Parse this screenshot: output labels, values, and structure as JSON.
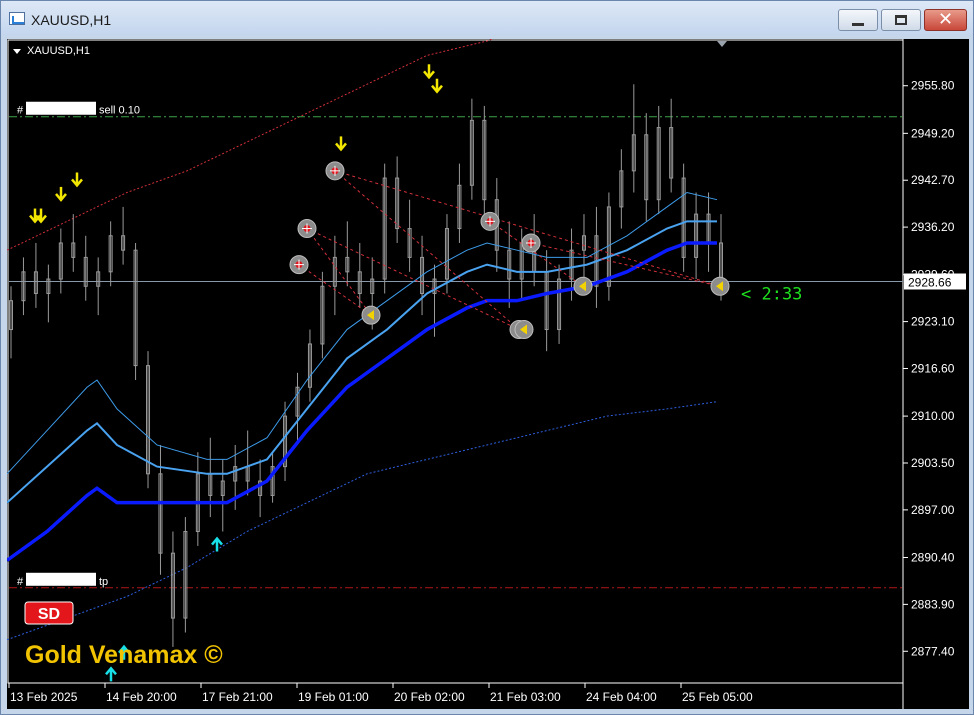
{
  "window": {
    "title": "XAUUSD,H1",
    "controls": {
      "minimize": "minimize",
      "maximize": "maximize",
      "close": "✕"
    }
  },
  "chart_header": {
    "symbol": "XAUUSD,H1"
  },
  "colors": {
    "background": "#000000",
    "candles": "#9a9a9a",
    "upper_band": "#d2303a",
    "ma_light": "#3d9be9",
    "ma_mid": "#4aa3f0",
    "ma_thick": "#0b1bff",
    "ma_slow": "#2e5fe0",
    "sell_line": "#3da34a",
    "tp_line": "#b01818",
    "current_price_line": "#8a98ac",
    "arrow_up": "#17e0e8",
    "arrow_down": "#f2e600",
    "countdown": "#1ee01e",
    "brand_text": "#f2c400",
    "sd_badge": "#e3161b"
  },
  "orders": {
    "sell": {
      "prefix": "#",
      "label": "sell 0.10"
    },
    "tp": {
      "prefix": "#",
      "label": "tp"
    }
  },
  "countdown": "< 2:33",
  "badge": "SD",
  "brand": "Gold Venamax ©",
  "chart_data": {
    "type": "candlestick",
    "symbol": "XAUUSD",
    "timeframe": "H1",
    "ylim": [
      2873.0,
      2962.0
    ],
    "y_ticks": [
      "2955.80",
      "2949.20",
      "2942.70",
      "2936.20",
      "2929.60",
      "2923.10",
      "2916.60",
      "2910.00",
      "2903.50",
      "2897.00",
      "2890.40",
      "2883.90",
      "2877.40"
    ],
    "x_ticks": [
      "13 Feb 2025",
      "14 Feb 20:00",
      "17 Feb 21:00",
      "19 Feb 01:00",
      "20 Feb 02:00",
      "21 Feb 03:00",
      "24 Feb 04:00",
      "25 Feb 05:00"
    ],
    "current_price": "2928.66",
    "current_price_value": 2928.66,
    "sell_level": 2951.5,
    "tp_level": 2886.2,
    "ohlc": [
      [
        2922,
        2928,
        2918,
        2926
      ],
      [
        2926,
        2932,
        2924,
        2930
      ],
      [
        2930,
        2934,
        2925,
        2927
      ],
      [
        2927,
        2931,
        2923,
        2929
      ],
      [
        2929,
        2936,
        2927,
        2934
      ],
      [
        2934,
        2938,
        2930,
        2932
      ],
      [
        2932,
        2935,
        2926,
        2928
      ],
      [
        2928,
        2932,
        2924,
        2930
      ],
      [
        2930,
        2937,
        2928,
        2935
      ],
      [
        2935,
        2939,
        2931,
        2933
      ],
      [
        2933,
        2934,
        2915,
        2917
      ],
      [
        2917,
        2919,
        2900,
        2902
      ],
      [
        2902,
        2906,
        2888,
        2891
      ],
      [
        2891,
        2894,
        2878,
        2882
      ],
      [
        2882,
        2896,
        2880,
        2894
      ],
      [
        2894,
        2905,
        2892,
        2902
      ],
      [
        2902,
        2907,
        2896,
        2899
      ],
      [
        2899,
        2904,
        2894,
        2901
      ],
      [
        2901,
        2906,
        2897,
        2903
      ],
      [
        2903,
        2908,
        2899,
        2901
      ],
      [
        2901,
        2904,
        2896,
        2899
      ],
      [
        2899,
        2905,
        2898,
        2903
      ],
      [
        2903,
        2912,
        2901,
        2910
      ],
      [
        2910,
        2916,
        2906,
        2914
      ],
      [
        2914,
        2922,
        2912,
        2920
      ],
      [
        2920,
        2930,
        2918,
        2928
      ],
      [
        2928,
        2935,
        2924,
        2932
      ],
      [
        2932,
        2937,
        2928,
        2930
      ],
      [
        2930,
        2934,
        2925,
        2927
      ],
      [
        2927,
        2932,
        2922,
        2929
      ],
      [
        2929,
        2945,
        2927,
        2943
      ],
      [
        2943,
        2946,
        2934,
        2936
      ],
      [
        2936,
        2940,
        2930,
        2932
      ],
      [
        2932,
        2935,
        2924,
        2927
      ],
      [
        2927,
        2931,
        2921,
        2929
      ],
      [
        2929,
        2938,
        2927,
        2936
      ],
      [
        2936,
        2945,
        2934,
        2942
      ],
      [
        2942,
        2954,
        2940,
        2951
      ],
      [
        2951,
        2953,
        2938,
        2940
      ],
      [
        2940,
        2943,
        2930,
        2933
      ],
      [
        2933,
        2937,
        2925,
        2929
      ],
      [
        2929,
        2936,
        2926,
        2934
      ],
      [
        2934,
        2938,
        2928,
        2930
      ],
      [
        2930,
        2933,
        2919,
        2922
      ],
      [
        2922,
        2931,
        2920,
        2929
      ],
      [
        2929,
        2936,
        2926,
        2933
      ],
      [
        2933,
        2938,
        2929,
        2935
      ],
      [
        2935,
        2939,
        2925,
        2928
      ],
      [
        2928,
        2941,
        2926,
        2939
      ],
      [
        2939,
        2947,
        2936,
        2944
      ],
      [
        2944,
        2956,
        2941,
        2949
      ],
      [
        2949,
        2952,
        2937,
        2940
      ],
      [
        2940,
        2953,
        2938,
        2950
      ],
      [
        2950,
        2954,
        2941,
        2943
      ],
      [
        2943,
        2945,
        2930,
        2932
      ],
      [
        2932,
        2941,
        2929,
        2938
      ],
      [
        2938,
        2941,
        2930,
        2934
      ],
      [
        2934,
        2938,
        2926,
        2929
      ]
    ],
    "ma_light": [
      [
        0,
        2902
      ],
      [
        40,
        2908
      ],
      [
        80,
        2914
      ],
      [
        90,
        2915
      ],
      [
        110,
        2911
      ],
      [
        150,
        2906
      ],
      [
        200,
        2904
      ],
      [
        220,
        2904
      ],
      [
        260,
        2907
      ],
      [
        300,
        2915
      ],
      [
        340,
        2922
      ],
      [
        380,
        2926
      ],
      [
        420,
        2930
      ],
      [
        460,
        2933
      ],
      [
        480,
        2934
      ],
      [
        510,
        2933
      ],
      [
        540,
        2932
      ],
      [
        580,
        2932
      ],
      [
        620,
        2935
      ],
      [
        660,
        2939
      ],
      [
        680,
        2941
      ],
      [
        710,
        2940
      ]
    ],
    "ma_mid": [
      [
        0,
        2898
      ],
      [
        40,
        2903
      ],
      [
        80,
        2908
      ],
      [
        90,
        2909
      ],
      [
        110,
        2906
      ],
      [
        150,
        2903
      ],
      [
        200,
        2902
      ],
      [
        220,
        2902
      ],
      [
        260,
        2904
      ],
      [
        300,
        2911
      ],
      [
        340,
        2918
      ],
      [
        380,
        2922
      ],
      [
        420,
        2927
      ],
      [
        460,
        2930
      ],
      [
        480,
        2931
      ],
      [
        510,
        2930
      ],
      [
        540,
        2930
      ],
      [
        580,
        2931
      ],
      [
        620,
        2933
      ],
      [
        660,
        2936
      ],
      [
        680,
        2937
      ],
      [
        710,
        2937
      ]
    ],
    "ma_thick": [
      [
        0,
        2890
      ],
      [
        40,
        2894
      ],
      [
        80,
        2899
      ],
      [
        90,
        2900
      ],
      [
        110,
        2898
      ],
      [
        150,
        2898
      ],
      [
        200,
        2898
      ],
      [
        220,
        2898
      ],
      [
        260,
        2901
      ],
      [
        300,
        2908
      ],
      [
        340,
        2914
      ],
      [
        380,
        2918
      ],
      [
        420,
        2922
      ],
      [
        460,
        2925
      ],
      [
        480,
        2926
      ],
      [
        510,
        2926
      ],
      [
        540,
        2927
      ],
      [
        580,
        2928
      ],
      [
        620,
        2930
      ],
      [
        660,
        2933
      ],
      [
        680,
        2934
      ],
      [
        710,
        2934
      ]
    ],
    "ma_slow": [
      [
        0,
        2879
      ],
      [
        60,
        2882
      ],
      [
        120,
        2885
      ],
      [
        180,
        2889
      ],
      [
        240,
        2894
      ],
      [
        300,
        2898
      ],
      [
        360,
        2902
      ],
      [
        420,
        2904
      ],
      [
        480,
        2906
      ],
      [
        540,
        2908
      ],
      [
        600,
        2910
      ],
      [
        660,
        2911
      ],
      [
        710,
        2912
      ]
    ],
    "upper_band": [
      [
        0,
        2933
      ],
      [
        60,
        2937
      ],
      [
        120,
        2941
      ],
      [
        180,
        2944
      ],
      [
        240,
        2948
      ],
      [
        300,
        2952
      ],
      [
        360,
        2956
      ],
      [
        420,
        2960
      ],
      [
        480,
        2962
      ],
      [
        500,
        2963
      ]
    ],
    "arrows_down": [
      [
        28,
        2936
      ],
      [
        34,
        2936
      ],
      [
        54,
        2939
      ],
      [
        70,
        2941
      ],
      [
        334,
        2946
      ],
      [
        422,
        2956
      ],
      [
        430,
        2954
      ]
    ],
    "arrows_up": [
      [
        104,
        2876
      ],
      [
        117,
        2879
      ],
      [
        210,
        2894
      ]
    ],
    "signals_entry": [
      [
        292,
        2931
      ],
      [
        300,
        2936
      ],
      [
        328,
        2944
      ],
      [
        483,
        2937
      ],
      [
        524,
        2934
      ]
    ],
    "signals_exit": [
      [
        364,
        2924
      ],
      [
        512,
        2922
      ],
      [
        517,
        2922
      ],
      [
        576,
        2928
      ],
      [
        713,
        2928
      ]
    ],
    "trade_lines": [
      [
        [
          292,
          2931
        ],
        [
          364,
          2924
        ]
      ],
      [
        [
          300,
          2936
        ],
        [
          364,
          2924
        ]
      ],
      [
        [
          300,
          2936
        ],
        [
          512,
          2922
        ]
      ],
      [
        [
          328,
          2944
        ],
        [
          512,
          2922
        ]
      ],
      [
        [
          328,
          2944
        ],
        [
          713,
          2928
        ]
      ],
      [
        [
          483,
          2937
        ],
        [
          576,
          2928
        ]
      ],
      [
        [
          524,
          2934
        ],
        [
          713,
          2928
        ]
      ]
    ]
  }
}
